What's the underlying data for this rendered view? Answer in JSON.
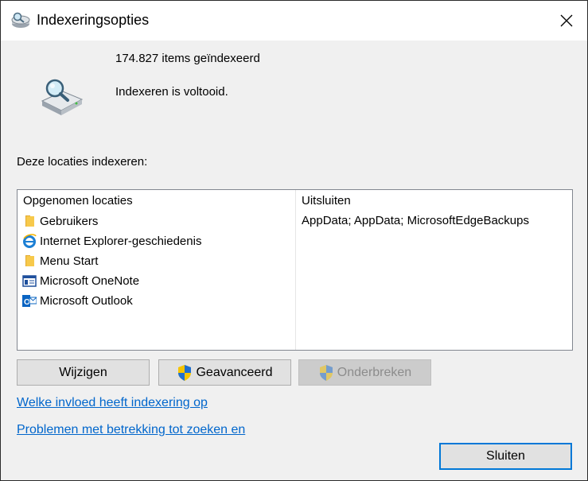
{
  "window": {
    "title": "Indexeringsopties"
  },
  "summary": {
    "items_indexed": "174.827 items geïndexeerd",
    "status": "Indexeren is voltooid."
  },
  "locations_label": "Deze locaties indexeren:",
  "list": {
    "col_included": "Opgenomen locaties",
    "col_exclude": "Uitsluiten",
    "locations": [
      {
        "label": "Gebruikers",
        "icon": "folder-icon"
      },
      {
        "label": "Internet Explorer-geschiedenis",
        "icon": "internet-explorer-icon"
      },
      {
        "label": "Menu Start",
        "icon": "folder-icon"
      },
      {
        "label": "Microsoft OneNote",
        "icon": "onenote-icon"
      },
      {
        "label": "Microsoft Outlook",
        "icon": "outlook-icon"
      }
    ],
    "exclude_first_row": "AppData; AppData; MicrosoftEdgeBackups"
  },
  "buttons": {
    "modify": "Wijzigen",
    "advanced": "Geavanceerd",
    "pause": "Onderbreken",
    "close": "Sluiten"
  },
  "links": {
    "how_indexing_affects": "Welke invloed heeft indexering op",
    "troubleshoot": "Problemen met betrekking tot zoeken en"
  },
  "colors": {
    "accent": "#0078d7",
    "link": "#0066cc",
    "folder": "#f7c94b"
  }
}
